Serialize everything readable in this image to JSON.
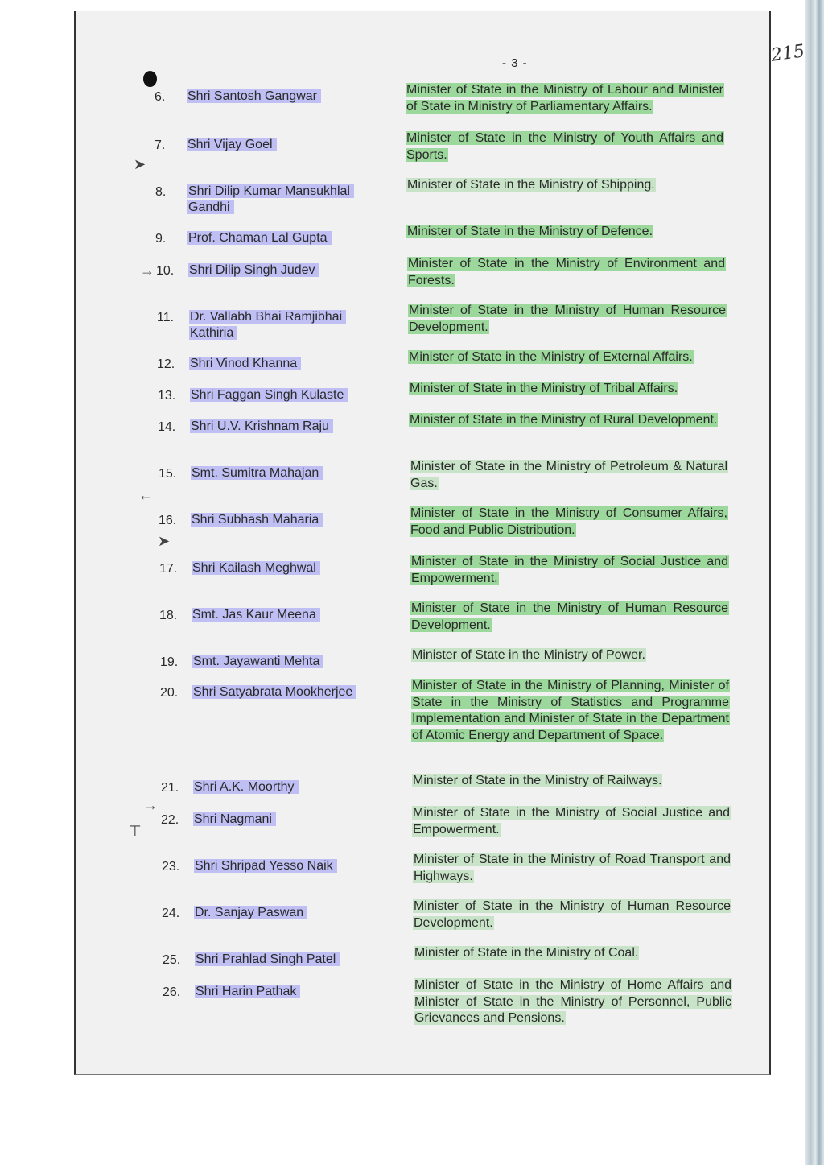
{
  "header": {
    "page_number": "- 3 -",
    "folio": "215"
  },
  "ministers": [
    {
      "no": "6.",
      "name": "Shri Santosh Gangwar",
      "portfolio": "Minister of State in the Ministry of Labour and Minister of State in Ministry of Parliamentary Affairs."
    },
    {
      "no": "7.",
      "name": "Shri Vijay Goel",
      "portfolio": "Minister of State in the Ministry of Youth Affairs and Sports."
    },
    {
      "no": "8.",
      "name": "Shri Dilip Kumar Mansukhlal Gandhi",
      "portfolio": "Minister of State in the Ministry of Shipping."
    },
    {
      "no": "9.",
      "name": "Prof. Chaman Lal Gupta",
      "portfolio": "Minister of State in the Ministry of Defence."
    },
    {
      "no": "10.",
      "name": "Shri Dilip Singh Judev",
      "portfolio": "Minister of State in the Ministry of Environment and Forests."
    },
    {
      "no": "11.",
      "name": "Dr. Vallabh Bhai Ramjibhai Kathiria",
      "portfolio": "Minister of State in the Ministry of Human Resource Development."
    },
    {
      "no": "12.",
      "name": "Shri Vinod Khanna",
      "portfolio": "Minister of State in the Ministry of External Affairs."
    },
    {
      "no": "13.",
      "name": "Shri Faggan Singh Kulaste",
      "portfolio": "Minister of State in the Ministry of Tribal Affairs."
    },
    {
      "no": "14.",
      "name": "Shri U.V. Krishnam Raju",
      "portfolio": "Minister of State in the Ministry of Rural Development."
    },
    {
      "no": "15.",
      "name": "Smt. Sumitra Mahajan",
      "portfolio": "Minister of State in the Ministry of Petroleum & Natural Gas."
    },
    {
      "no": "16.",
      "name": "Shri Subhash Maharia",
      "portfolio": "Minister of State in the Ministry of Consumer Affairs, Food and Public Distribution."
    },
    {
      "no": "17.",
      "name": "Shri Kailash Meghwal",
      "portfolio": "Minister of State in the Ministry of Social Justice and Empowerment."
    },
    {
      "no": "18.",
      "name": "Smt. Jas Kaur Meena",
      "portfolio": "Minister of State in the Ministry of Human Resource Development."
    },
    {
      "no": "19.",
      "name": "Smt. Jayawanti Mehta",
      "portfolio": "Minister of State in the Ministry of Power."
    },
    {
      "no": "20.",
      "name": "Shri Satyabrata Mookherjee",
      "portfolio": "Minister of State in the Ministry of Planning, Minister of State in the Ministry of Statistics and Programme Implementation and Minister of State in the Department of Atomic Energy and Department of Space."
    },
    {
      "no": "21.",
      "name": "Shri A.K. Moorthy",
      "portfolio": "Minister of State in the Ministry of Railways."
    },
    {
      "no": "22.",
      "name": "Shri Nagmani",
      "portfolio": "Minister of State in the Ministry of Social Justice and Empowerment."
    },
    {
      "no": "23.",
      "name": "Shri Shripad Yesso Naik",
      "portfolio": "Minister of State in the Ministry of Road Transport and Highways."
    },
    {
      "no": "24.",
      "name": "Dr. Sanjay Paswan",
      "portfolio": "Minister of State in the Ministry of Human Resource Development."
    },
    {
      "no": "25.",
      "name": "Shri Prahlad Singh Patel",
      "portfolio": "Minister of State in the Ministry of Coal."
    },
    {
      "no": "26.",
      "name": "Shri Harin Pathak",
      "portfolio": "Minister of State in the Ministry of Home Affairs and Minister of State in the Ministry of Personnel, Public Grievances and Pensions."
    }
  ]
}
